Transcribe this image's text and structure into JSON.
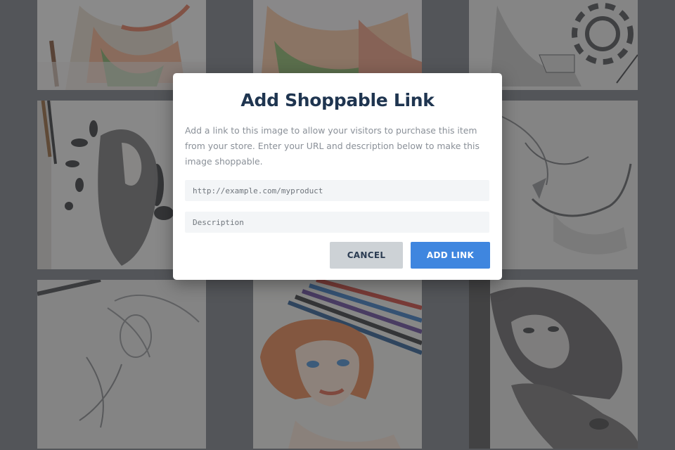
{
  "gallery": {
    "images": [
      {
        "name": "mermaid-colored-pencil"
      },
      {
        "name": "mermaid-colored-closeup"
      },
      {
        "name": "girl-with-spiral"
      },
      {
        "name": "girl-with-flowers"
      },
      {
        "name": "center-hidden"
      },
      {
        "name": "mermaid-sketch-right"
      },
      {
        "name": "mermaid-sketch-left"
      },
      {
        "name": "redhead-portrait"
      },
      {
        "name": "girl-with-dragon"
      }
    ]
  },
  "modal": {
    "title": "Add Shoppable Link",
    "description": "Add a link to this image to allow your visitors to purchase this item from your store. Enter your URL and description below to make this image shoppable.",
    "url_placeholder": "http://example.com/myproduct",
    "url_value": "",
    "description_placeholder": "Description",
    "description_value": "",
    "cancel_label": "CANCEL",
    "add_label": "ADD LINK"
  },
  "colors": {
    "title": "#1f3550",
    "primary": "#3f86df",
    "secondary": "#cdd2d6"
  }
}
